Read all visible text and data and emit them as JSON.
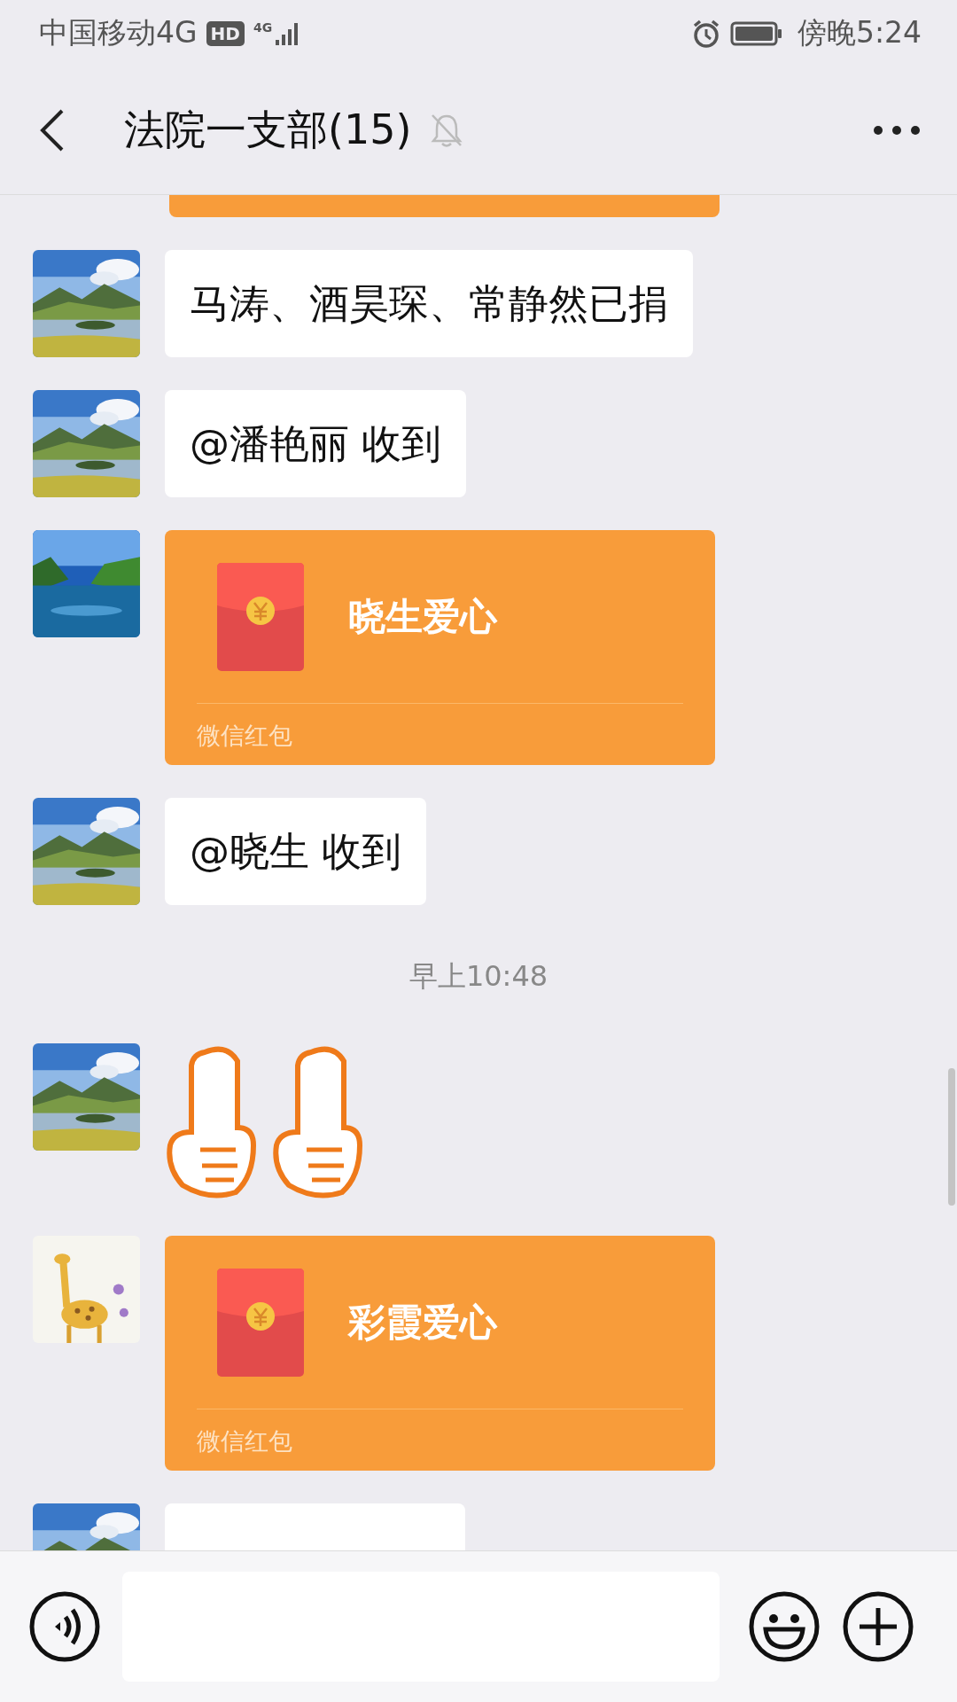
{
  "status_bar": {
    "carrier": "中国移动4G",
    "hd_badge": "HD",
    "network_badge": "4G",
    "time": "傍晚5:24"
  },
  "header": {
    "title": "法院一支部(15)",
    "muted": true
  },
  "messages": [
    {
      "kind": "cut_red_packet"
    },
    {
      "kind": "text",
      "text": "马涛、酒昊琛、常静然已捐"
    },
    {
      "kind": "text",
      "text": "@潘艳丽  收到"
    },
    {
      "kind": "red_packet",
      "title": "晓生爱心",
      "label": "微信红包"
    },
    {
      "kind": "text",
      "text": "@晓生  收到"
    },
    {
      "kind": "time",
      "text": "早上10:48"
    },
    {
      "kind": "sticker"
    },
    {
      "kind": "red_packet",
      "title": "彩霞爱心",
      "label": "微信红包"
    },
    {
      "kind": "cut_text"
    }
  ]
}
